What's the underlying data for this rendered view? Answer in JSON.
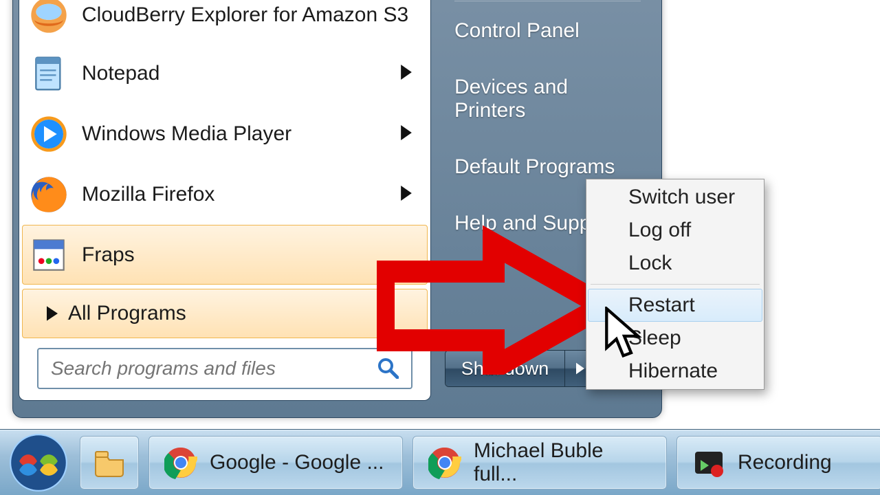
{
  "programs": [
    {
      "label": "CloudBerry Explorer for Amazon S3",
      "submenu": false,
      "icon": "cloudberry-icon",
      "selected": false
    },
    {
      "label": "Notepad",
      "submenu": true,
      "icon": "notepad-icon",
      "selected": false
    },
    {
      "label": "Windows Media Player",
      "submenu": true,
      "icon": "wmp-icon",
      "selected": false
    },
    {
      "label": "Mozilla Firefox",
      "submenu": true,
      "icon": "firefox-icon",
      "selected": false
    },
    {
      "label": "Fraps",
      "submenu": false,
      "icon": "fraps-icon",
      "selected": true
    }
  ],
  "all_programs_label": "All Programs",
  "search_placeholder": "Search programs and files",
  "right_links": [
    "Control Panel",
    "Devices and Printers",
    "Default Programs",
    "Help and Support"
  ],
  "shutdown_label": "Shut down",
  "power_menu": {
    "group1": [
      "Switch user",
      "Log off",
      "Lock"
    ],
    "group2": [
      "Restart",
      "Sleep",
      "Hibernate"
    ],
    "selected": "Restart"
  },
  "taskbar": [
    {
      "label": "",
      "icon": "explorer-icon",
      "pinned": true
    },
    {
      "label": "Google - Google ...",
      "icon": "chrome-icon",
      "pinned": false
    },
    {
      "label": "Michael Buble full...",
      "icon": "chrome-icon",
      "pinned": false
    },
    {
      "label": "Recording",
      "icon": "record-icon",
      "pinned": false
    }
  ]
}
